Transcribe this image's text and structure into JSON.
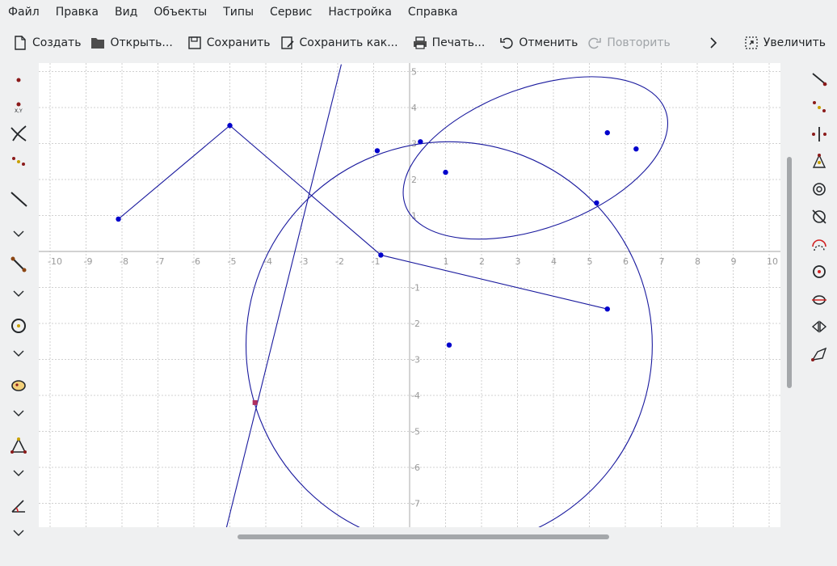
{
  "menu": [
    "Файл",
    "Правка",
    "Вид",
    "Объекты",
    "Типы",
    "Сервис",
    "Настройка",
    "Справка"
  ],
  "toolbar": {
    "create": "Создать",
    "open": "Открыть...",
    "save": "Сохранить",
    "save_as": "Сохранить как...",
    "print": "Печать...",
    "undo": "Отменить",
    "redo": "Повторить",
    "zoom_in": "Увеличить"
  },
  "left_tools": [
    "point-icon",
    "point-by-coords-icon",
    "intersection-icon",
    "point-set-icon",
    "line-icon",
    "expand-more-icon",
    "segment-icon",
    "expand-more-icon",
    "circle-icon",
    "expand-more-icon",
    "polygon-icon",
    "expand-more-icon",
    "triangle-icon",
    "expand-more-icon",
    "angle-icon",
    "expand-more-icon"
  ],
  "right_tools": [
    "ray-icon",
    "point-on-curve-icon",
    "perpendicular-icon",
    "triangle-points-icon",
    "spiral-icon",
    "circle-cross-icon",
    "arc-icon",
    "concentric-icon",
    "tangent-icon",
    "mirror-icon",
    "vector-icon"
  ],
  "axes": {
    "x_ticks": [
      "-10",
      "-9",
      "-8",
      "-7",
      "-6",
      "-5",
      "-4",
      "-3",
      "-2",
      "-1",
      "1",
      "2",
      "3",
      "4",
      "5",
      "6",
      "7",
      "8",
      "9",
      "10"
    ],
    "y_ticks": [
      "5",
      "4",
      "3",
      "2",
      "1",
      "-1",
      "-2",
      "-3",
      "-4",
      "-5",
      "-6",
      "-7"
    ]
  },
  "colors": {
    "geometry": "#1a1a9e",
    "point": "#0000cc",
    "special_point": "#b03060",
    "grid": "#d0d0d0",
    "axis": "#b8b8b8"
  }
}
